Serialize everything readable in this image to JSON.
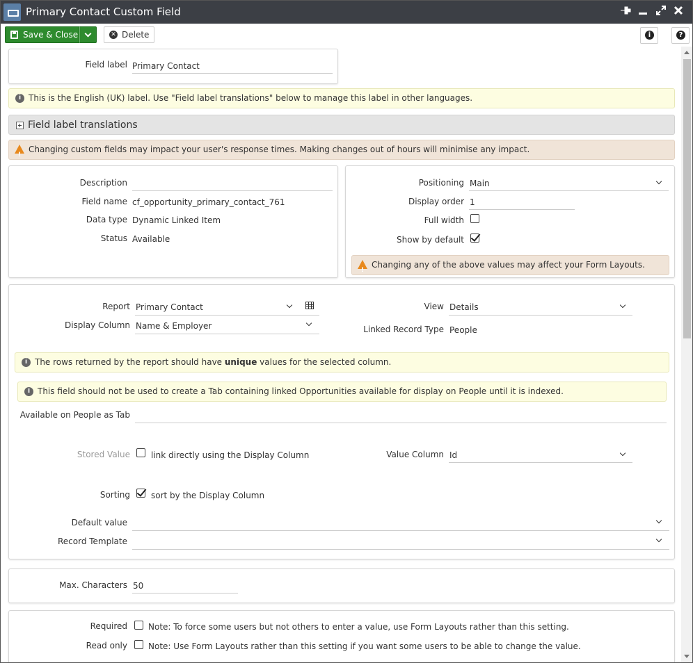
{
  "window": {
    "title": "Primary Contact Custom Field",
    "controls": [
      "pin-icon",
      "minimize-icon",
      "maximize-icon",
      "close-icon"
    ]
  },
  "toolbar": {
    "save_label": "Save & Close",
    "delete_label": "Delete",
    "info_icon": "info-icon",
    "help_icon": "help-icon"
  },
  "field_label_panel": {
    "label": "Field label",
    "value": "Primary Contact"
  },
  "notes": {
    "english_label": "This is the English (UK) label. Use \"Field label translations\" below to manage this label in other languages.",
    "response_time": "Changing custom fields may impact your user's response times. Making changes out of hours will minimise any impact.",
    "form_layouts": "Changing any of the above values may affect your Form Layouts.",
    "unique_prefix": "The rows returned by the report should have ",
    "unique_bold": "unique",
    "unique_suffix": " values for the selected column.",
    "indexed": "This field should not be used to create a Tab containing linked Opportunities available for display on People until it is indexed."
  },
  "translations": {
    "label": "Field label translations"
  },
  "details": {
    "description_label": "Description",
    "description_value": "",
    "field_name_label": "Field name",
    "field_name_value": "cf_opportunity_primary_contact_761",
    "data_type_label": "Data type",
    "data_type_value": "Dynamic Linked Item",
    "status_label": "Status",
    "status_value": "Available"
  },
  "positioning": {
    "positioning_label": "Positioning",
    "positioning_value": "Main",
    "display_order_label": "Display order",
    "display_order_value": "1",
    "full_width_label": "Full width",
    "full_width_checked": false,
    "show_default_label": "Show by default",
    "show_default_checked": true
  },
  "linked": {
    "report_label": "Report",
    "report_value": "Primary Contact",
    "display_column_label": "Display Column",
    "display_column_value": "Name & Employer",
    "view_label": "View",
    "view_value": "Details",
    "linked_type_label": "Linked Record Type",
    "linked_type_value": "People",
    "available_tab_label": "Available on People as Tab",
    "available_tab_value": "",
    "stored_value_label": "Stored Value",
    "stored_value_checkbox_label": "link directly using the Display Column",
    "stored_value_checked": false,
    "value_column_label": "Value Column",
    "value_column_value": "Id",
    "sorting_label": "Sorting",
    "sorting_checkbox_label": "sort by the Display Column",
    "sorting_checked": true,
    "default_value_label": "Default value",
    "default_value_value": "",
    "record_template_label": "Record Template",
    "record_template_value": ""
  },
  "max_chars": {
    "label": "Max. Characters",
    "value": "50"
  },
  "required": {
    "required_label": "Required",
    "required_note": "Note: To force some users but not others to enter a value, use Form Layouts rather than this setting.",
    "required_checked": false,
    "readonly_label": "Read only",
    "readonly_note": "Note: Use Form Layouts rather than this setting if you want some users to be able to change the value.",
    "readonly_checked": false
  },
  "colors": {
    "titlebar": "#3c3f45",
    "save_green": "#2e8b2e",
    "info_note_bg": "#fdfde1",
    "warn_note_bg": "#f0e4d8",
    "warn_icon": "#e8891d"
  }
}
